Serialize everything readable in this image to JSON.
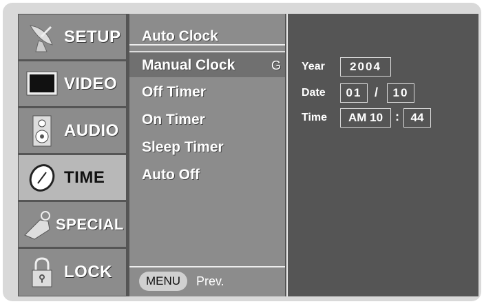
{
  "nav": {
    "items": [
      {
        "label": "SETUP",
        "icon": "satellite-dish-icon"
      },
      {
        "label": "VIDEO",
        "icon": "monitor-icon"
      },
      {
        "label": "AUDIO",
        "icon": "speaker-icon"
      },
      {
        "label": "TIME",
        "icon": "clock-icon",
        "active": true
      },
      {
        "label": "SPECIAL",
        "icon": "tag-icon"
      },
      {
        "label": "LOCK",
        "icon": "padlock-icon"
      }
    ]
  },
  "menu": {
    "items": [
      {
        "label": "Auto Clock"
      },
      {
        "label": "Manual Clock",
        "selected": true,
        "arrow": "G"
      },
      {
        "label": "Off Timer"
      },
      {
        "label": "On Timer"
      },
      {
        "label": "Sleep Timer"
      },
      {
        "label": "Auto Off"
      }
    ],
    "footer": {
      "button": "MENU",
      "label": "Prev."
    }
  },
  "panel": {
    "year": {
      "label": "Year",
      "value": "2004"
    },
    "date": {
      "label": "Date",
      "month": "01",
      "sep": "/",
      "day": "10"
    },
    "time": {
      "label": "Time",
      "hour": "AM 10",
      "sep": ":",
      "minute": "44"
    }
  },
  "colors": {
    "screen_bg": "#555555",
    "menu_bg": "#8c8c8c",
    "active_nav": "#b8b8b8"
  }
}
